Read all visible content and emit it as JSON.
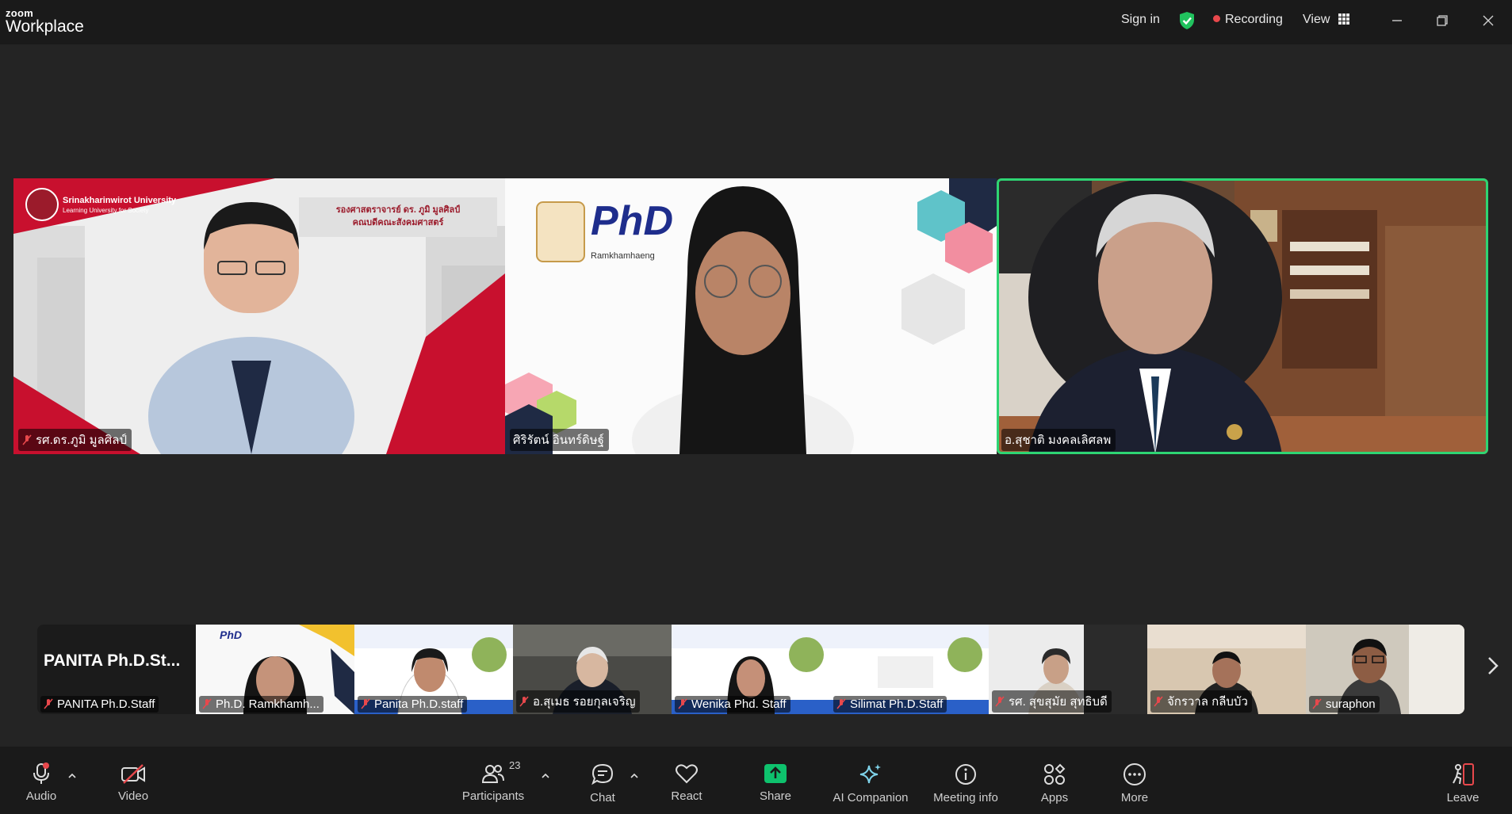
{
  "titlebar": {
    "brand_small": "zoom",
    "brand_big": "Workplace",
    "sign_in": "Sign in",
    "recording": "Recording",
    "view": "View"
  },
  "main_tiles": [
    {
      "name": "รศ.ดร.ภูมิ มูลศิลป์",
      "banner_title": "Srinakharinwirot University",
      "banner_sub": "Learning University for Society",
      "banner_name": "รองศาสตราจารย์ ดร. ภูมิ มูลศิลป์",
      "banner_role": "คณบดีคณะสังคมศาสตร์"
    },
    {
      "name": "ศิริรัตน์ อินทร์ดิษฐ์",
      "logo_text": "PhD",
      "logo_sub": "Ramkhamhaeng"
    },
    {
      "name": "อ.สุชาติ มงคลเลิศลพ"
    }
  ],
  "thumbnails": [
    {
      "name": "PANITA Ph.D.Staff",
      "display_text": "PANITA  Ph.D.St..."
    },
    {
      "name": "Ph.D. Ramkhamh..."
    },
    {
      "name": "Panita Ph.D.staff"
    },
    {
      "name": "อ.สุเมธ รอยกุลเจริญ"
    },
    {
      "name": "Wenika Phd. Staff"
    },
    {
      "name": "Silimat Ph.D.Staff"
    },
    {
      "name": "รศ. สุขสุมัย สุทธิบดี"
    },
    {
      "name": "จักรวาล กลีบบัว"
    },
    {
      "name": "suraphon"
    }
  ],
  "toolbar": {
    "audio": "Audio",
    "video": "Video",
    "participants": "Participants",
    "participants_count": "23",
    "chat": "Chat",
    "react": "React",
    "share": "Share",
    "ai_companion": "AI Companion",
    "meeting_info": "Meeting info",
    "apps": "Apps",
    "more": "More",
    "leave": "Leave"
  },
  "colors": {
    "active_speaker": "#2ed573",
    "share_green": "#0ec26d",
    "recording_red": "#e8484c",
    "muted_red": "#e8484c"
  }
}
